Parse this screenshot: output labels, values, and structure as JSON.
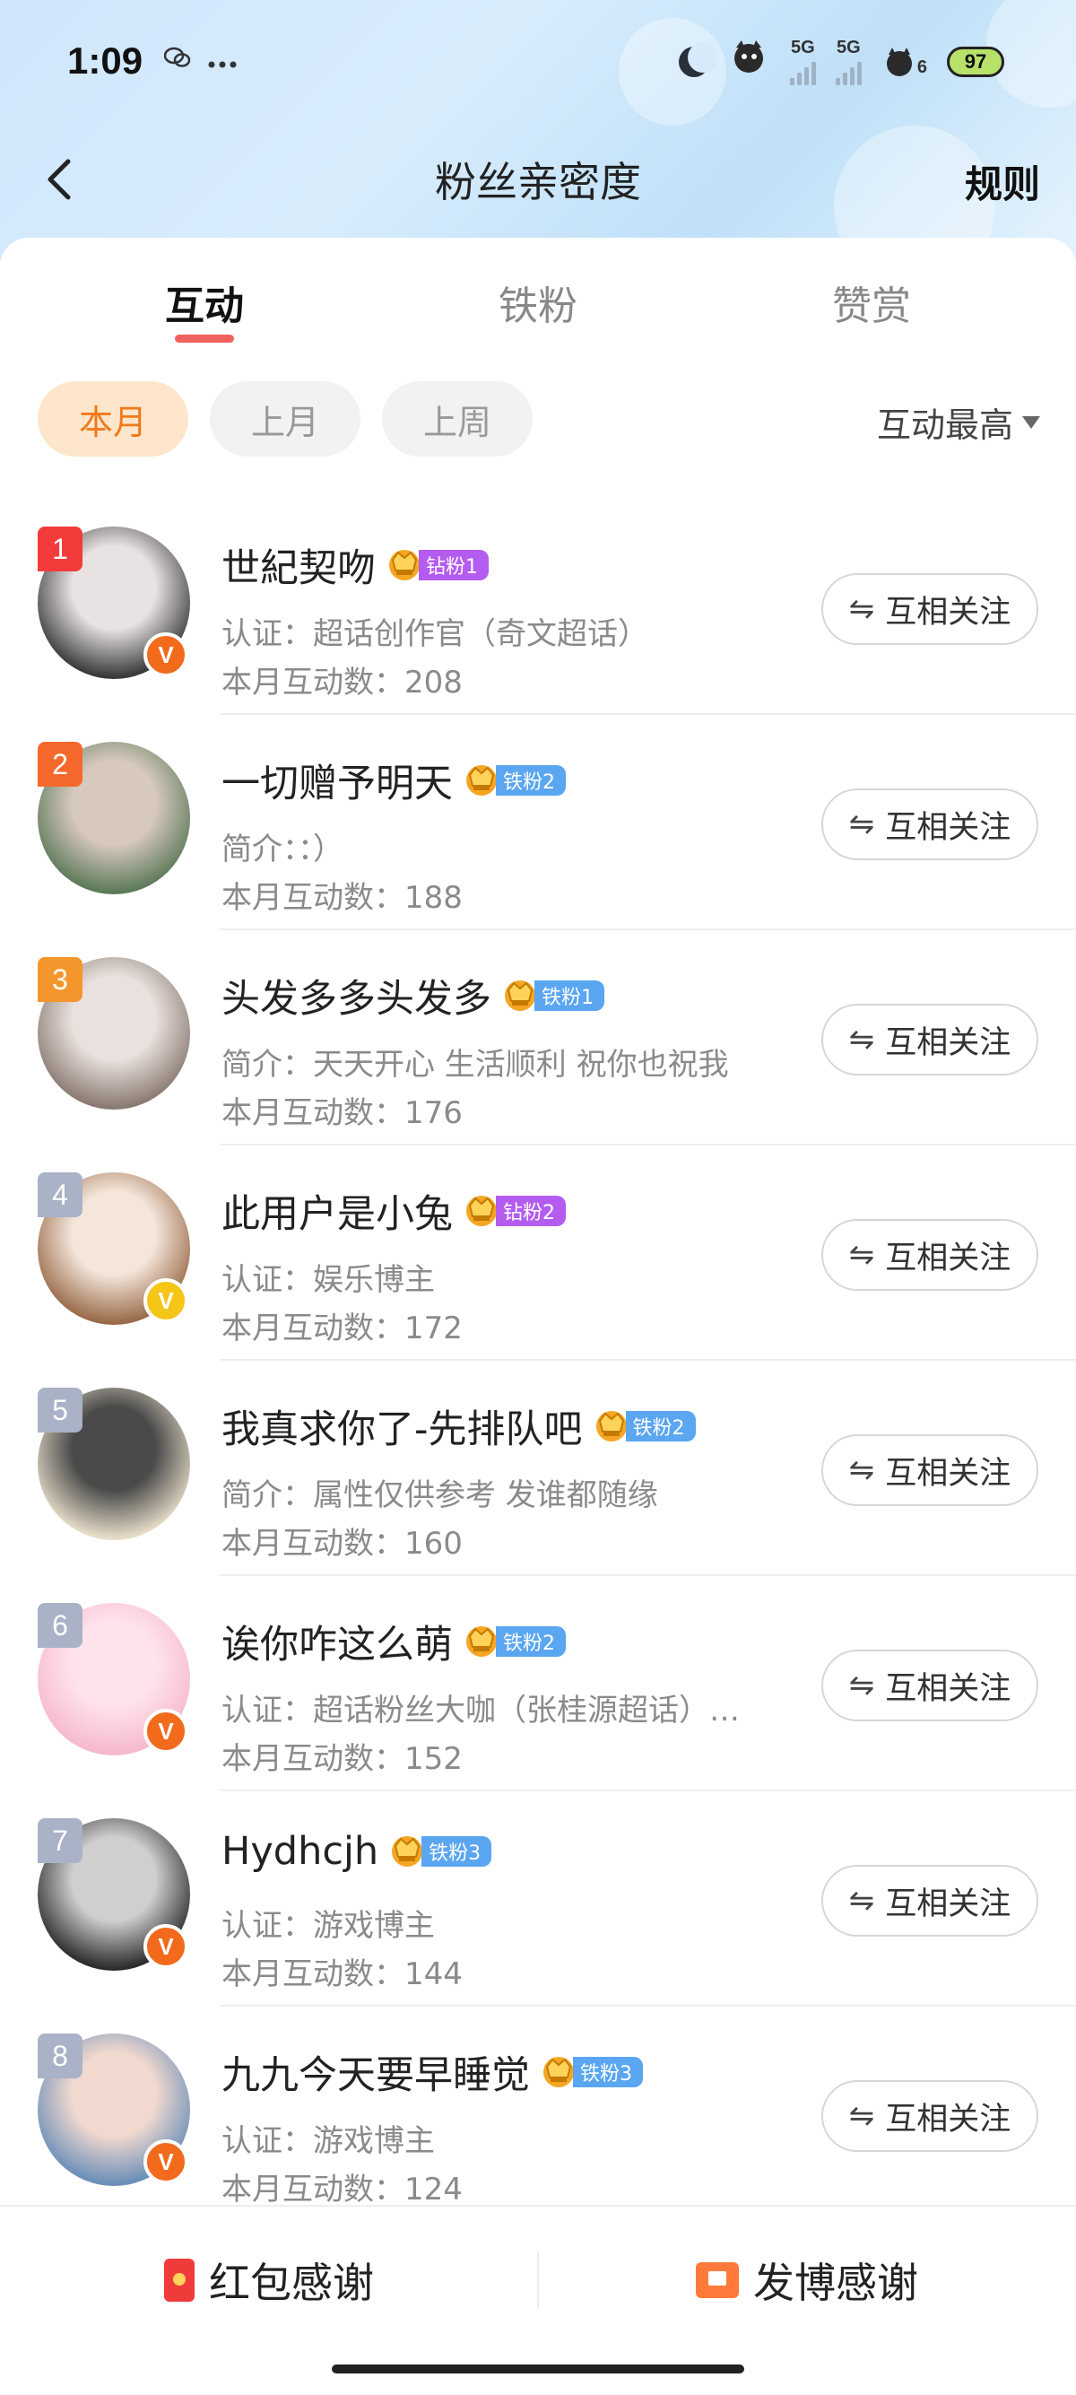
{
  "status": {
    "time": "1:09",
    "signal1": "5G",
    "signal2": "5G",
    "sim_count": "6",
    "battery": "97"
  },
  "nav": {
    "title": "粉丝亲密度",
    "rules": "规则"
  },
  "tabs": [
    {
      "label": "互动"
    },
    {
      "label": "铁粉"
    },
    {
      "label": "赞赏"
    }
  ],
  "filters": [
    {
      "label": "本月"
    },
    {
      "label": "上月"
    },
    {
      "label": "上周"
    }
  ],
  "sort_label": "互动最高",
  "follow_label": "互相关注",
  "items": [
    {
      "rank": "1",
      "rank_color": "#f43b3b",
      "name": "世紀契吻",
      "badge": "钻粉1",
      "badge_color": "#b45cf0",
      "sub": "认证：超话创作官（奇文超话）",
      "count": "本月互动数：208",
      "verify": "orange",
      "avatar_colors": [
        "#3a3a3a",
        "#e8e2e2"
      ]
    },
    {
      "rank": "2",
      "rank_color": "#f56a2c",
      "name": "一切赠予明天",
      "badge": "铁粉2",
      "badge_color": "#5aa6f0",
      "sub": "简介：：）",
      "count": "本月互动数：188",
      "verify": "",
      "avatar_colors": [
        "#5d7a5a",
        "#d8c9bf"
      ]
    },
    {
      "rank": "3",
      "rank_color": "#f5962c",
      "name": "头发多多头发多",
      "badge": "铁粉1",
      "badge_color": "#5aa6f0",
      "sub": "简介：天天开心 生活顺利 祝你也祝我",
      "count": "本月互动数：176",
      "verify": "",
      "avatar_colors": [
        "#8a7b72",
        "#e9e1de"
      ]
    },
    {
      "rank": "4",
      "rank_color": "#a9b2c6",
      "name": "此用户是小兔",
      "badge": "钻粉2",
      "badge_color": "#b45cf0",
      "sub": "认证：娱乐博主",
      "count": "本月互动数：172",
      "verify": "gold",
      "avatar_colors": [
        "#9a6b4a",
        "#f4e6da"
      ]
    },
    {
      "rank": "5",
      "rank_color": "#a9b2c6",
      "name": "我真求你了-先排队吧",
      "badge": "铁粉2",
      "badge_color": "#5aa6f0",
      "sub": "简介：属性仅供参考 发谁都随缘",
      "count": "本月互动数：160",
      "verify": "",
      "avatar_colors": [
        "#e6dcc8",
        "#4a4a4a"
      ]
    },
    {
      "rank": "6",
      "rank_color": "#a9b2c6",
      "name": "诶你咋这么萌",
      "badge": "铁粉2",
      "badge_color": "#5aa6f0",
      "sub": "认证：超话粉丝大咖（张桂源超话）…",
      "count": "本月互动数：152",
      "verify": "orange",
      "avatar_colors": [
        "#f6b9cf",
        "#ffe3ec"
      ]
    },
    {
      "rank": "7",
      "rank_color": "#a9b2c6",
      "name": "Hydhcjh",
      "badge": "铁粉3",
      "badge_color": "#5aa6f0",
      "sub": "认证：游戏博主",
      "count": "本月互动数：144",
      "verify": "orange",
      "avatar_colors": [
        "#2c2c2c",
        "#cfcfcf"
      ]
    },
    {
      "rank": "8",
      "rank_color": "#a9b2c6",
      "name": "九九今天要早睡觉",
      "badge": "铁粉3",
      "badge_color": "#5aa6f0",
      "sub": "认证：游戏博主",
      "count": "本月互动数：124",
      "verify": "orange",
      "avatar_colors": [
        "#6b8fb8",
        "#f2d9cf"
      ]
    }
  ],
  "bottom": {
    "left_label": "红包感谢",
    "right_label": "发博感谢"
  }
}
